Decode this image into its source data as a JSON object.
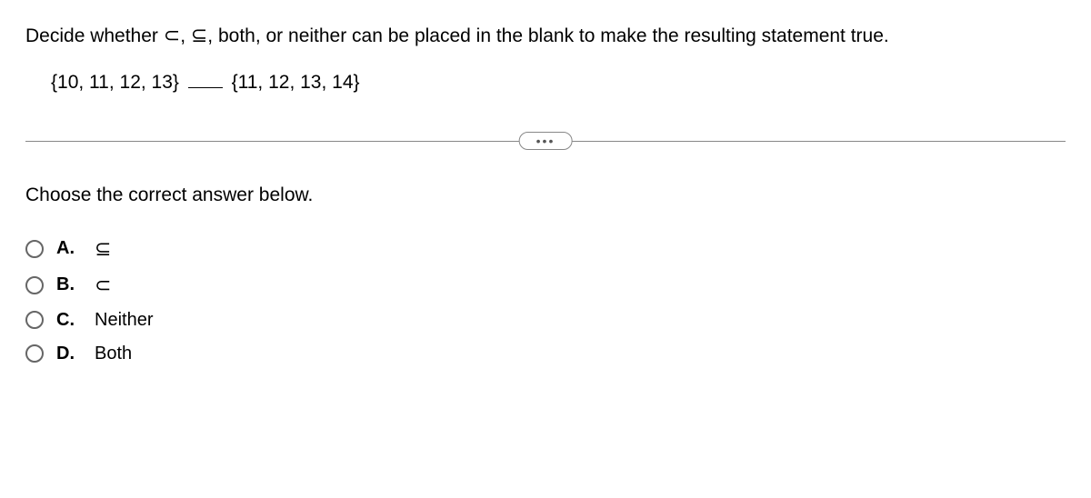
{
  "question": {
    "text_before": "Decide whether ",
    "sym1": "⊂",
    "sep1": ", ",
    "sym2": "⊆",
    "text_after": ", both, or neither can be placed in the blank to make the resulting statement true."
  },
  "expression": {
    "left_set": "{10, 11, 12, 13}",
    "right_set": "{11, 12, 13, 14}"
  },
  "ellipsis": "…",
  "instruction": "Choose the correct answer below.",
  "options": [
    {
      "label": "A.",
      "text": "⊆",
      "class": "subset-eq"
    },
    {
      "label": "B.",
      "text": "⊂",
      "class": "subset-proper"
    },
    {
      "label": "C.",
      "text": "Neither",
      "class": ""
    },
    {
      "label": "D.",
      "text": "Both",
      "class": ""
    }
  ]
}
